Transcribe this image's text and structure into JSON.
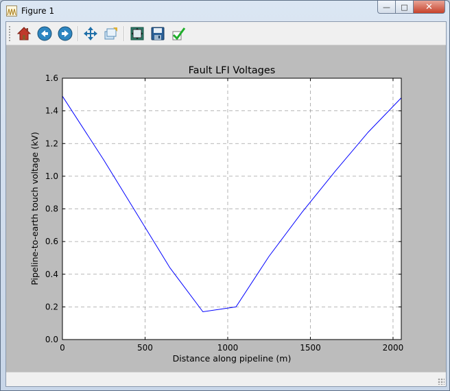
{
  "window": {
    "title": "Figure 1"
  },
  "title_buttons": {
    "minimize": "—",
    "maximize": "□",
    "close": "✕"
  },
  "toolbar": {
    "icons": [
      "home-icon",
      "back-icon",
      "forward-icon",
      "pan-icon",
      "zoom-icon",
      "subplots-icon",
      "save-icon",
      "edit-icon"
    ]
  },
  "colors": {
    "line": "#0000ff",
    "figure_bg": "#bcbcbc",
    "axes_bg": "#ffffff"
  },
  "chart_data": {
    "type": "line",
    "title": "Fault LFI Voltages",
    "xlabel": "Distance along pipeline (m)",
    "ylabel": "Pipeline-to-earth touch voltage (kV)",
    "xlim": [
      0,
      2050
    ],
    "ylim": [
      0.0,
      1.6
    ],
    "xticks": [
      0,
      500,
      1000,
      1500,
      2000
    ],
    "xtick_labels": [
      "0",
      "500",
      "1000",
      "1500",
      "2000"
    ],
    "yticks": [
      0.0,
      0.2,
      0.4,
      0.6,
      0.8,
      1.0,
      1.2,
      1.4,
      1.6
    ],
    "ytick_labels": [
      "0.0",
      "0.2",
      "0.4",
      "0.6",
      "0.8",
      "1.0",
      "1.2",
      "1.4",
      "1.6"
    ],
    "grid": true,
    "series": [
      {
        "x": [
          0,
          250,
          450,
          650,
          850,
          1050,
          1250,
          1450,
          1650,
          1850,
          2050
        ],
        "y": [
          1.49,
          1.1,
          0.77,
          0.44,
          0.17,
          0.2,
          0.51,
          0.78,
          1.03,
          1.27,
          1.48
        ]
      }
    ]
  }
}
